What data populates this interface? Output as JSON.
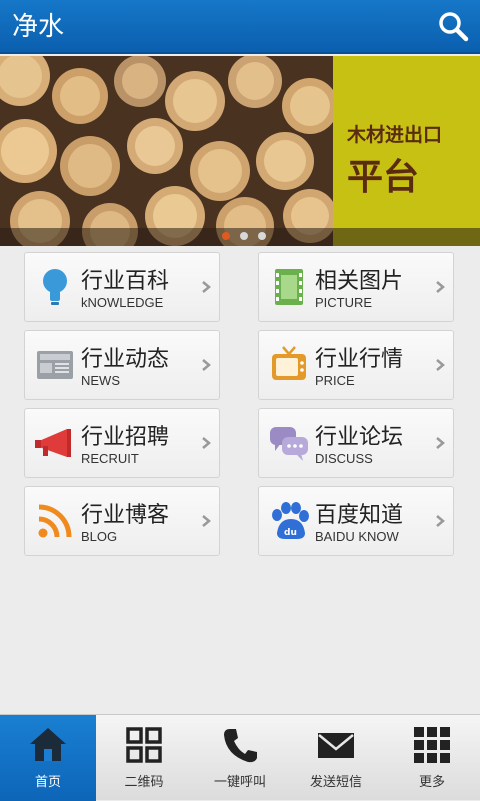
{
  "header": {
    "title": "净水",
    "search_icon": "search-icon"
  },
  "banner": {
    "line1": "木材进出口",
    "line2": "平台",
    "accent_color": "#c6c113"
  },
  "grid": [
    {
      "cn": "行业百科",
      "en": "kNOWLEDGE",
      "icon": "lightbulb-icon"
    },
    {
      "cn": "相关图片",
      "en": "PICTURE",
      "icon": "film-icon"
    },
    {
      "cn": "行业动态",
      "en": "NEWS",
      "icon": "newspaper-icon"
    },
    {
      "cn": "行业行情",
      "en": "PRICE",
      "icon": "tv-icon"
    },
    {
      "cn": "行业招聘",
      "en": "RECRUIT",
      "icon": "megaphone-icon"
    },
    {
      "cn": "行业论坛",
      "en": "DISCUSS",
      "icon": "chat-bubbles-icon"
    },
    {
      "cn": "行业博客",
      "en": "BLOG",
      "icon": "rss-icon"
    },
    {
      "cn": "百度知道",
      "en": "BAIDU KNOW",
      "icon": "baidu-paw-icon"
    }
  ],
  "bottom_nav": [
    {
      "label": "首页",
      "icon": "home-icon",
      "active": true
    },
    {
      "label": "二维码",
      "icon": "grid-icon",
      "active": false
    },
    {
      "label": "一键呼叫",
      "icon": "phone-icon",
      "active": false
    },
    {
      "label": "发送短信",
      "icon": "envelope-icon",
      "active": false
    },
    {
      "label": "更多",
      "icon": "more-grid-icon",
      "active": false
    }
  ],
  "colors": {
    "header": "#0b5fae",
    "active_tab": "#1a7fd2"
  }
}
